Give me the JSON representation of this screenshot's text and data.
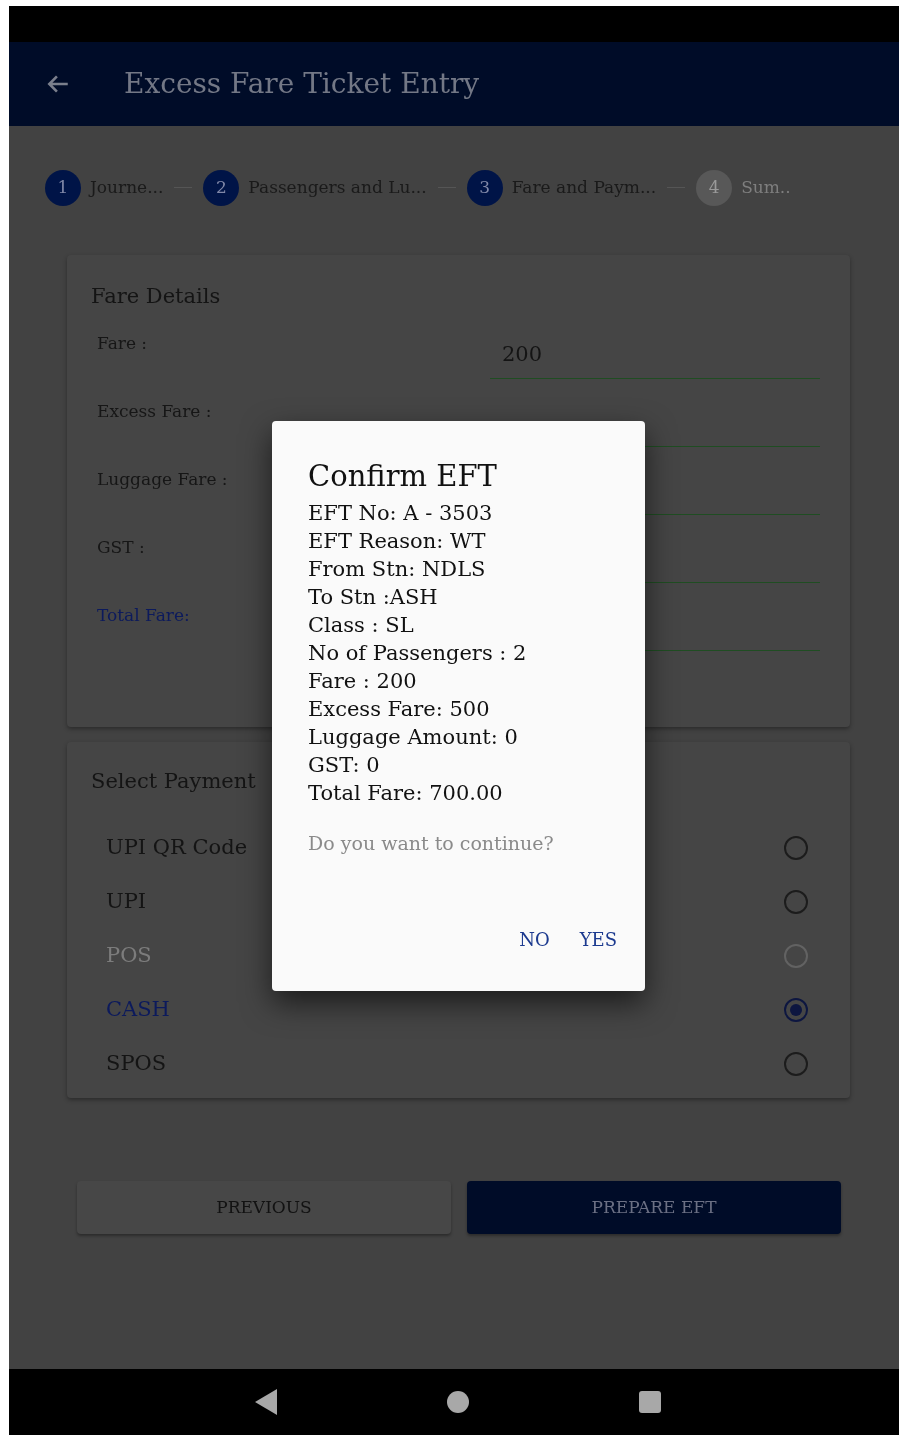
{
  "app_bar": {
    "title": "Excess Fare Ticket Entry"
  },
  "stepper": [
    {
      "number": "1",
      "label": "Journe...",
      "disabled": false
    },
    {
      "number": "2",
      "label": "Passengers and Lu...",
      "disabled": false
    },
    {
      "number": "3",
      "label": "Fare and Paym...",
      "disabled": false
    },
    {
      "number": "4",
      "label": "Sum..",
      "disabled": true
    }
  ],
  "fare_details": {
    "title": "Fare Details",
    "rows": [
      {
        "label": "Fare :",
        "value": "200",
        "highlight": false
      },
      {
        "label": "Excess Fare :",
        "highlight": false
      },
      {
        "label": "Luggage Fare :",
        "highlight": false
      },
      {
        "label": "GST :",
        "highlight": false
      },
      {
        "label": "Total Fare:",
        "highlight": true
      }
    ]
  },
  "payment": {
    "title": "Select Payment",
    "options": [
      {
        "label": "UPI QR Code",
        "selected": false,
        "disabled": false
      },
      {
        "label": "UPI",
        "selected": false,
        "disabled": false
      },
      {
        "label": "POS",
        "selected": false,
        "disabled": true
      },
      {
        "label": "CASH",
        "selected": true,
        "disabled": false
      },
      {
        "label": "SPOS",
        "selected": false,
        "disabled": false
      }
    ]
  },
  "buttons": [
    {
      "label": "PREVIOUS",
      "kind": "secondary"
    },
    {
      "label": "PREPARE EFT",
      "kind": "primary"
    }
  ],
  "dialog": {
    "title": "Confirm EFT",
    "lines": [
      "EFT No: A - 3503",
      "EFT Reason: WT",
      "From Stn: NDLS",
      "To Stn :ASH",
      "Class : SL",
      "No of Passengers : 2",
      "Fare : 200",
      "Excess Fare: 500",
      "Luggage Amount: 0",
      "GST: 0",
      "Total Fare: 700.00"
    ],
    "question": "Do you want to continue?",
    "actions": [
      "NO",
      "YES"
    ]
  }
}
